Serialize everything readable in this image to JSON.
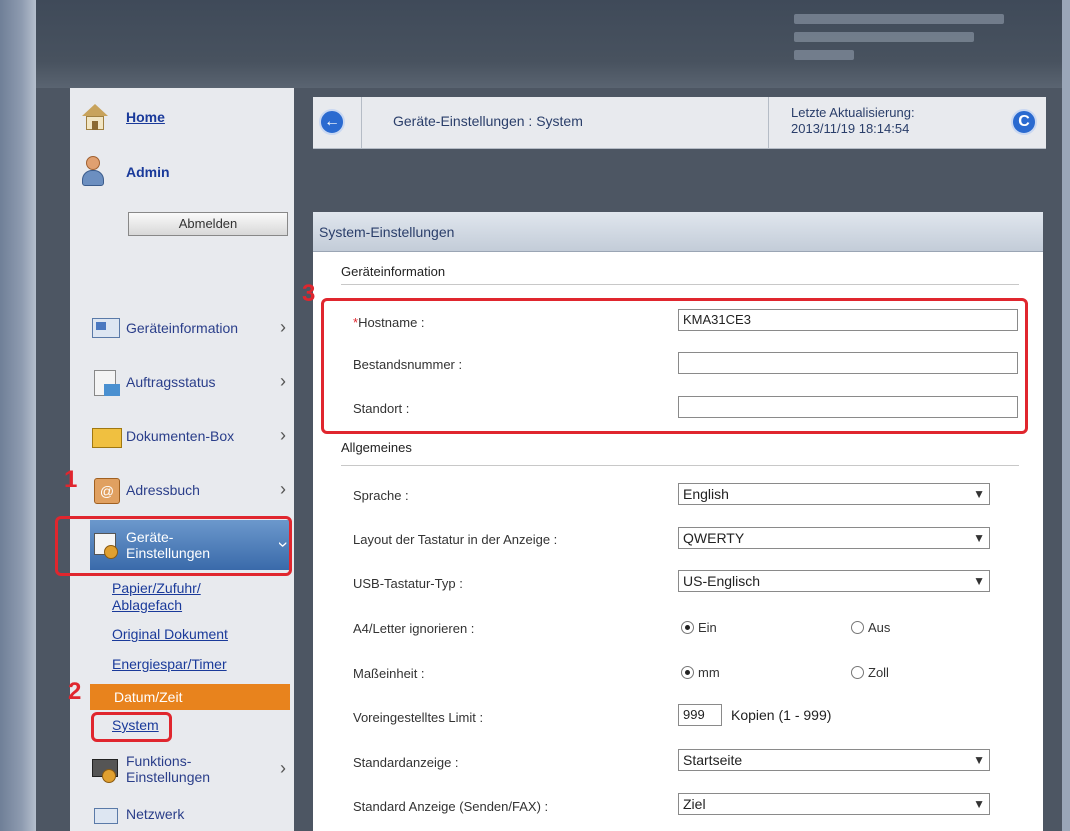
{
  "sidebar": {
    "home": "Home",
    "admin": "Admin",
    "logout": "Abmelden",
    "nav": [
      {
        "label": "Geräteinformation"
      },
      {
        "label": "Auftragsstatus"
      },
      {
        "label": "Dokumenten-Box"
      },
      {
        "label": "Adressbuch"
      },
      {
        "label": "Geräte-\nEinstellungen"
      },
      {
        "label": "Funktions-\nEinstellungen"
      },
      {
        "label": "Netzwerk"
      }
    ],
    "sub": {
      "paper": "Papier/Zufuhr/\nAblagefach",
      "original": "Original Dokument",
      "energy": "Energiespar/Timer",
      "datetime": "Datum/Zeit",
      "system": "System"
    }
  },
  "header": {
    "breadcrumb": "Geräte-Einstellungen : System",
    "updated_label": "Letzte Aktualisierung:",
    "updated_value": "2013/11/19 18:14:54"
  },
  "panel": {
    "title": "System-Einstellungen",
    "sec1": "Geräteinformation",
    "hostname_label": "Hostname :",
    "hostname_value": "KMA31CE3",
    "asset_label": "Bestandsnummer :",
    "asset_value": "",
    "location_label": "Standort :",
    "location_value": "",
    "sec2": "Allgemeines",
    "lang_label": "Sprache :",
    "lang_value": "English",
    "kbd_label": "Layout der Tastatur in der Anzeige :",
    "kbd_value": "QWERTY",
    "usb_label": "USB-Tastatur-Typ :",
    "usb_value": "US-Englisch",
    "a4_label": "A4/Letter ignorieren :",
    "a4_on": "Ein",
    "a4_off": "Aus",
    "unit_label": "Maßeinheit :",
    "unit_mm": "mm",
    "unit_inch": "Zoll",
    "limit_label": "Voreingestelltes Limit :",
    "limit_value": "999",
    "limit_suffix": "Kopien (1 - 999)",
    "std_label": "Standardanzeige :",
    "std_value": "Startseite",
    "stdfax_label": "Standard Anzeige (Senden/FAX) :",
    "stdfax_value": "Ziel"
  },
  "annotations": {
    "n1": "1",
    "n2": "2",
    "n3": "3"
  },
  "colors": {
    "highlight": "#e0262e",
    "active_sub": "#e8831d",
    "nav_active": "#3a6aaa"
  }
}
